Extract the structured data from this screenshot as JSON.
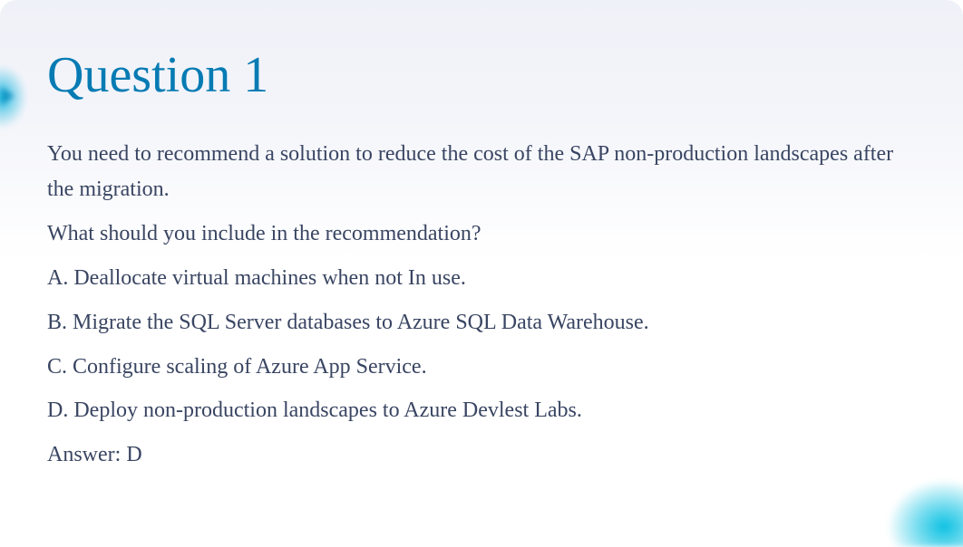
{
  "title": "Question 1",
  "intro_line1": "You need to recommend a solution to reduce the cost of the SAP non-production landscapes after the migration.",
  "intro_line2": "What should you include in the recommendation?",
  "option_a": "A. Deallocate virtual machines when not In use.",
  "option_b": "B. Migrate the SQL Server databases to Azure SQL Data Warehouse.",
  "option_c": "C. Configure scaling of Azure App Service.",
  "option_d": "D. Deploy non-production landscapes to Azure Devlest Labs.",
  "answer": "Answer: D"
}
